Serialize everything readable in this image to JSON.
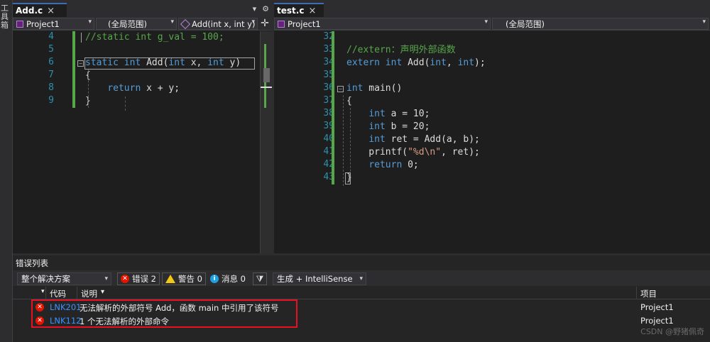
{
  "toolbox": {
    "label": "工具箱"
  },
  "left_editor": {
    "tab": {
      "title": "Add.c",
      "close": "×"
    },
    "tab_actions": {
      "dropdown": "▾",
      "settings": "⚙"
    },
    "nav": {
      "project": "Project1",
      "scope": "(全局范围)",
      "member": "Add(int x, int y)"
    },
    "lines": [
      {
        "num": "4",
        "parts": [
          {
            "t": "//static int g_val = 100;",
            "c": "cm"
          }
        ]
      },
      {
        "num": "5",
        "parts": []
      },
      {
        "num": "6",
        "parts": [
          {
            "t": "static",
            "c": "kw"
          },
          {
            "t": " ",
            "c": "tx"
          },
          {
            "t": "int",
            "c": "kw"
          },
          {
            "t": " Add(",
            "c": "tx"
          },
          {
            "t": "int",
            "c": "kw"
          },
          {
            "t": " x, ",
            "c": "tx"
          },
          {
            "t": "int",
            "c": "kw"
          },
          {
            "t": " y)",
            "c": "tx"
          }
        ]
      },
      {
        "num": "7",
        "parts": [
          {
            "t": "{",
            "c": "tx"
          }
        ]
      },
      {
        "num": "8",
        "parts": [
          {
            "t": "    ",
            "c": "tx"
          },
          {
            "t": "return",
            "c": "kw"
          },
          {
            "t": " x + y;",
            "c": "tx"
          }
        ]
      },
      {
        "num": "9",
        "parts": [
          {
            "t": "}",
            "c": "tx"
          }
        ]
      }
    ]
  },
  "right_editor": {
    "tab": {
      "title": "test.c",
      "close": "×"
    },
    "nav": {
      "project": "Project1",
      "scope": "(全局范围)"
    },
    "lines": [
      {
        "num": "32",
        "parts": []
      },
      {
        "num": "33",
        "parts": [
          {
            "t": "//extern：声明外部函数",
            "c": "cm"
          }
        ]
      },
      {
        "num": "34",
        "parts": [
          {
            "t": "extern",
            "c": "kw"
          },
          {
            "t": " ",
            "c": "tx"
          },
          {
            "t": "int",
            "c": "kw"
          },
          {
            "t": " Add(",
            "c": "tx"
          },
          {
            "t": "int",
            "c": "kw"
          },
          {
            "t": ", ",
            "c": "tx"
          },
          {
            "t": "int",
            "c": "kw"
          },
          {
            "t": ");",
            "c": "tx"
          }
        ]
      },
      {
        "num": "35",
        "parts": []
      },
      {
        "num": "36",
        "parts": [
          {
            "t": "int",
            "c": "kw"
          },
          {
            "t": " main()",
            "c": "tx"
          }
        ]
      },
      {
        "num": "37",
        "parts": [
          {
            "t": "{",
            "c": "tx"
          }
        ]
      },
      {
        "num": "38",
        "parts": [
          {
            "t": "    ",
            "c": "tx"
          },
          {
            "t": "int",
            "c": "kw"
          },
          {
            "t": " a = 10;",
            "c": "tx"
          }
        ]
      },
      {
        "num": "39",
        "parts": [
          {
            "t": "    ",
            "c": "tx"
          },
          {
            "t": "int",
            "c": "kw"
          },
          {
            "t": " b = 20;",
            "c": "tx"
          }
        ]
      },
      {
        "num": "40",
        "parts": [
          {
            "t": "    ",
            "c": "tx"
          },
          {
            "t": "int",
            "c": "kw"
          },
          {
            "t": " ret = Add(a, b);",
            "c": "tx"
          }
        ]
      },
      {
        "num": "41",
        "parts": [
          {
            "t": "    printf(",
            "c": "tx"
          },
          {
            "t": "\"%d\\n\"",
            "c": "st"
          },
          {
            "t": ", ret);",
            "c": "tx"
          }
        ]
      },
      {
        "num": "42",
        "parts": [
          {
            "t": "    ",
            "c": "tx"
          },
          {
            "t": "return",
            "c": "kw"
          },
          {
            "t": " 0;",
            "c": "tx"
          }
        ]
      },
      {
        "num": "43",
        "parts": [
          {
            "t": "}",
            "c": "tx"
          }
        ]
      }
    ]
  },
  "error_list": {
    "title": "错误列表",
    "scope_combo": "整个解决方案",
    "errors_btn": "错误 2",
    "warnings_btn": "警告 0",
    "messages_btn": "消息 0",
    "build_combo": "生成 + IntelliSense",
    "columns": {
      "code": "代码",
      "desc": "说明",
      "project": "项目",
      "sort": "▾"
    },
    "rows": [
      {
        "code": "LNK2019",
        "desc": "无法解析的外部符号 Add，函数 main 中引用了该符号",
        "project": "Project1"
      },
      {
        "code": "LNK1120",
        "desc": "1 个无法解析的外部命令",
        "project": "Project1"
      }
    ],
    "watermark": "CSDN @野猪佩奇"
  },
  "colors": {
    "accent": "#3e6db3",
    "error_highlight": "#e81123",
    "change_bar": "#57a64a"
  }
}
